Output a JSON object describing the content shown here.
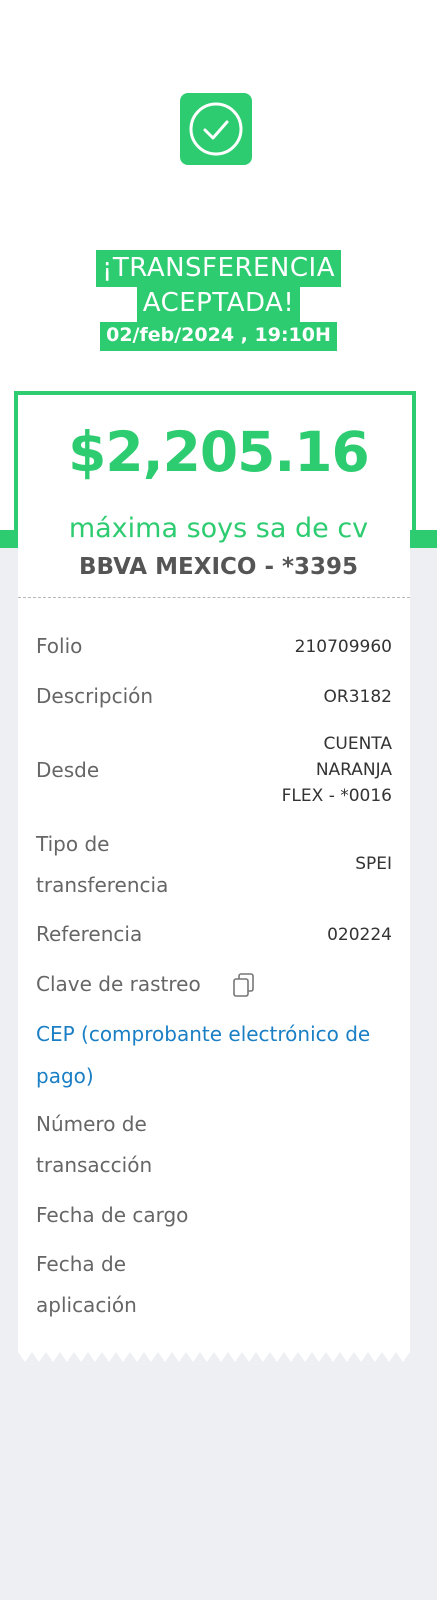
{
  "status": {
    "title_line1": "¡TRANSFERENCIA",
    "title_line2": "ACEPTADA!",
    "datetime": "02/feb/2024 , 19:10H"
  },
  "transfer": {
    "amount": "$2,205.16",
    "recipient": "máxima soys sa de cv",
    "bank": "BBVA MEXICO - *3395"
  },
  "details": {
    "folio_label": "Folio",
    "folio_value": "210709960",
    "descripcion_label": "Descripción",
    "descripcion_value": "OR3182",
    "desde_label": "Desde",
    "desde_value_l1": "CUENTA",
    "desde_value_l2": "NARANJA",
    "desde_value_l3": "FLEX - *0016",
    "tipo_label_l1": "Tipo de",
    "tipo_label_l2": "transferencia",
    "tipo_value": "SPEI",
    "referencia_label": "Referencia",
    "referencia_value": "020224",
    "clave_label": "Clave de rastreo",
    "cep_link_l1": "CEP (comprobante electrónico de",
    "cep_link_l2": "pago)",
    "numero_label_l1": "Número de",
    "numero_label_l2": "transacción",
    "fecha_cargo_label": "Fecha de cargo",
    "fecha_aplicacion_label_l1": "Fecha de",
    "fecha_aplicacion_label_l2": "aplicación"
  },
  "icons": {
    "status_icon": "check-circle-icon",
    "copy_icon": "copy-icon"
  },
  "colors": {
    "accent_green": "#2ecc71",
    "link_blue": "#1a7fc4",
    "background_gray": "#eeeff3"
  }
}
